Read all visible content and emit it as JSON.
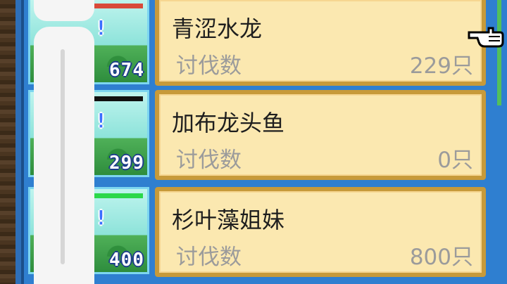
{
  "monster_list": [
    {
      "name": "青涩水龙",
      "label": "讨伐数",
      "value": "229只",
      "thumb_count": "674",
      "hp_bar": "red"
    },
    {
      "name": "加布龙头鱼",
      "label": "讨伐数",
      "value": "0只",
      "thumb_count": "299",
      "hp_bar": "black"
    },
    {
      "name": "杉叶藻姐妹",
      "label": "讨伐数",
      "value": "800只",
      "thumb_count": "400",
      "hp_bar": "green"
    }
  ],
  "icons": {
    "pointer": "pointing-hand-icon",
    "mark": "exclamation-icon"
  },
  "colors": {
    "panel_blue": "#2f7fd0",
    "card_bg": "#fbe8b0",
    "card_border": "#c79a3a",
    "text_gray": "#9b9b9b"
  }
}
